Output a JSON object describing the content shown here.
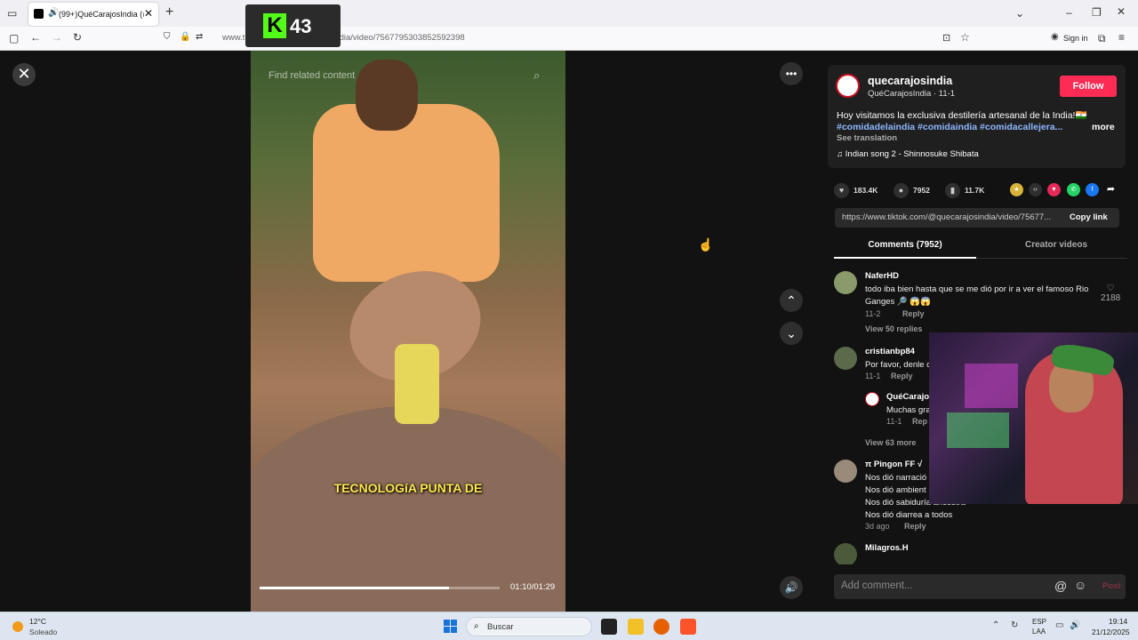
{
  "browser": {
    "tab_title": "(99+)QuéCarajosIndia (@q",
    "url": "www.tiktok.com/@quecarajosindia/video/7567795303852592398",
    "sign_in": "Sign in"
  },
  "overlay": {
    "badge_letter": "K",
    "badge_count": "43"
  },
  "video": {
    "search_placeholder": "Find related content",
    "caption": "TECNOLOGíA PUNTA DE",
    "time": "01:10/01:29",
    "progress_fraction": 0.79
  },
  "post": {
    "username": "quecarajosindia",
    "subname": "QuéCarajosIndia · 11-1",
    "follow_label": "Follow",
    "description": "Hoy visitamos la exclusiva destilería artesanal de la India!🇮🇳",
    "hashtags": "#comidadelaindia #comidaindia #comidacallejera...",
    "more_label": "more",
    "see_translation": "See translation",
    "music": "Indian song 2 - Shinnosuke Shibata",
    "likes": "183.4K",
    "comments_count": "7952",
    "saves": "11.7K",
    "link": "https://www.tiktok.com/@quecarajosindia/video/75677...",
    "copy_link": "Copy link"
  },
  "tabs": {
    "comments": "Comments (7952)",
    "creator": "Creator videos"
  },
  "comments": [
    {
      "user": "NaferHD",
      "text": "todo iba bien hasta que se me dió por ir a ver el famoso Rio Ganges 🔎 😱😱",
      "date": "11-2",
      "reply": "Reply",
      "replies": "View 50 replies",
      "likes": "2188"
    },
    {
      "user": "cristianbp84",
      "text": "Por favor, denle c",
      "date": "11-1",
      "reply": "Reply"
    },
    {
      "user": "QuéCarajo",
      "text": "Muchas gra",
      "date": "11-1",
      "reply": "Rep"
    },
    {
      "replies": "View 63 more"
    },
    {
      "user": "π Pingon FF √",
      "lines": [
        "Nos dió narració",
        "Nos dió ambient",
        "Nos dió sabiduría ancestra",
        "Nos dió diarrea a todos"
      ],
      "date": "3d ago",
      "reply": "Reply"
    },
    {
      "user": "Milagros.H"
    }
  ],
  "comment_input": {
    "placeholder": "Add comment...",
    "post": "Post"
  },
  "taskbar": {
    "temp": "12°C",
    "condition": "Soleado",
    "search": "Buscar",
    "lang1": "ESP",
    "lang2": "LAA",
    "time": "19:14",
    "date": "21/12/2025"
  }
}
